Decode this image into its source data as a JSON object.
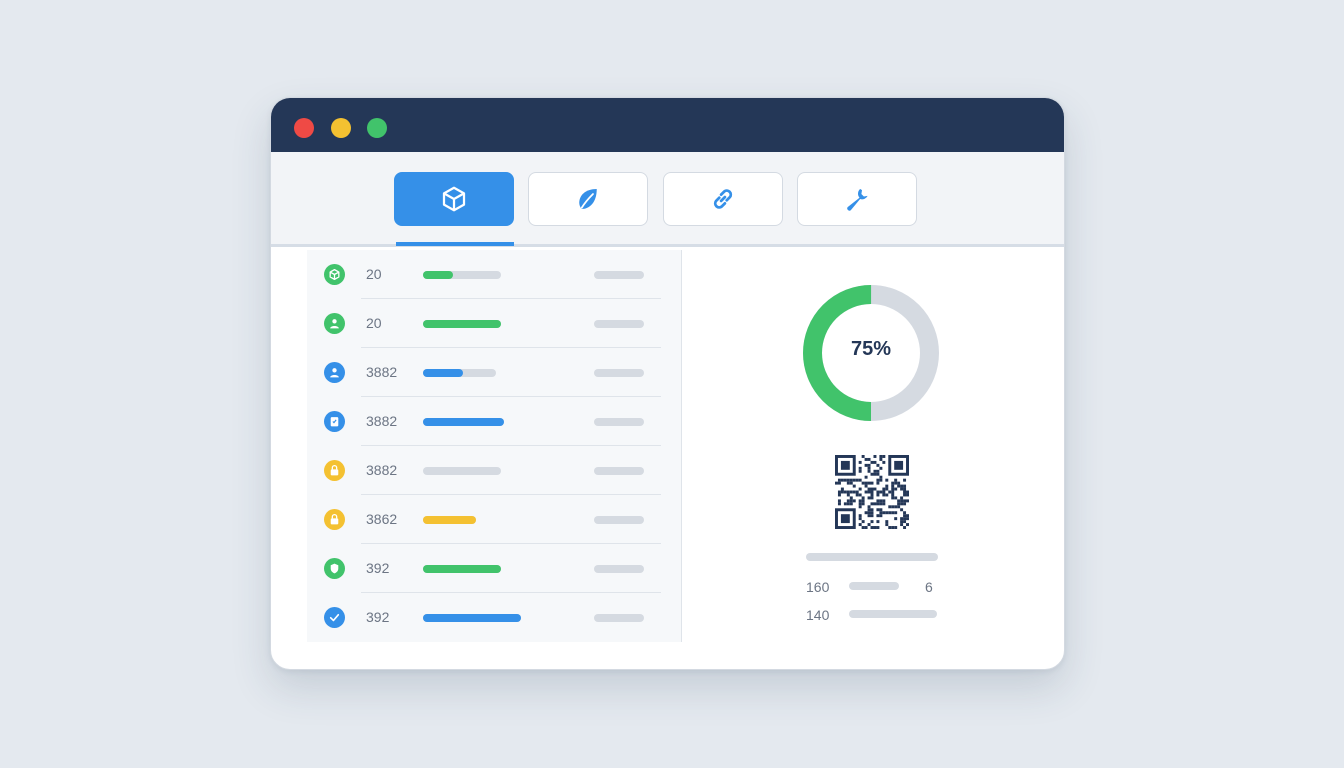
{
  "colors": {
    "titlebar": "#243757",
    "accent_blue": "#3590e8",
    "green": "#41c36b",
    "yellow": "#f4c131",
    "red": "#ef4a45",
    "track_gray": "#d5dae1"
  },
  "window": {
    "controls": [
      {
        "name": "close",
        "color": "#ef4a45"
      },
      {
        "name": "minimize",
        "color": "#f4c131"
      },
      {
        "name": "maximize",
        "color": "#41c36b"
      }
    ]
  },
  "toolbar": {
    "tabs": [
      {
        "icon": "cube-icon",
        "active": true
      },
      {
        "icon": "leaf-icon",
        "active": false
      },
      {
        "icon": "link-icon",
        "active": false
      },
      {
        "icon": "wrench-icon",
        "active": false
      }
    ]
  },
  "list": {
    "rows": [
      {
        "icon": "cube-icon",
        "icon_color": "#41c36b",
        "value": "20",
        "progress": 0.38,
        "bar_color": "#41c36b",
        "track_fraction": 1.0
      },
      {
        "icon": "user-icon",
        "icon_color": "#41c36b",
        "value": "20",
        "progress": 1.0,
        "bar_color": "#41c36b",
        "track_fraction": 1.0
      },
      {
        "icon": "user-icon",
        "icon_color": "#3590e8",
        "value": "3882",
        "progress": 0.55,
        "bar_color": "#3590e8",
        "track_fraction": 0.94
      },
      {
        "icon": "badge-icon",
        "icon_color": "#3590e8",
        "value": "3882",
        "progress": 1.0,
        "bar_color": "#3590e8",
        "track_fraction": 1.04
      },
      {
        "icon": "lock-icon",
        "icon_color": "#f4c131",
        "value": "3882",
        "progress": 0.0,
        "bar_color": "#f4c131",
        "track_fraction": 1.0
      },
      {
        "icon": "lock-icon",
        "icon_color": "#f4c131",
        "value": "3862",
        "progress": 1.0,
        "bar_color": "#f4c131",
        "track_fraction": 0.68
      },
      {
        "icon": "shield-icon",
        "icon_color": "#41c36b",
        "value": "392",
        "progress": 1.0,
        "bar_color": "#41c36b",
        "track_fraction": 1.0
      },
      {
        "icon": "check-icon",
        "icon_color": "#3590e8",
        "value": "392",
        "progress": 1.0,
        "bar_color": "#3590e8",
        "track_fraction": 1.26
      }
    ]
  },
  "summary": {
    "donut_percent": 75,
    "donut_label": "75%",
    "qr": "qr-code-icon",
    "stats": [
      {
        "label": "160",
        "value": "6"
      },
      {
        "label": "140",
        "value": ""
      }
    ]
  }
}
